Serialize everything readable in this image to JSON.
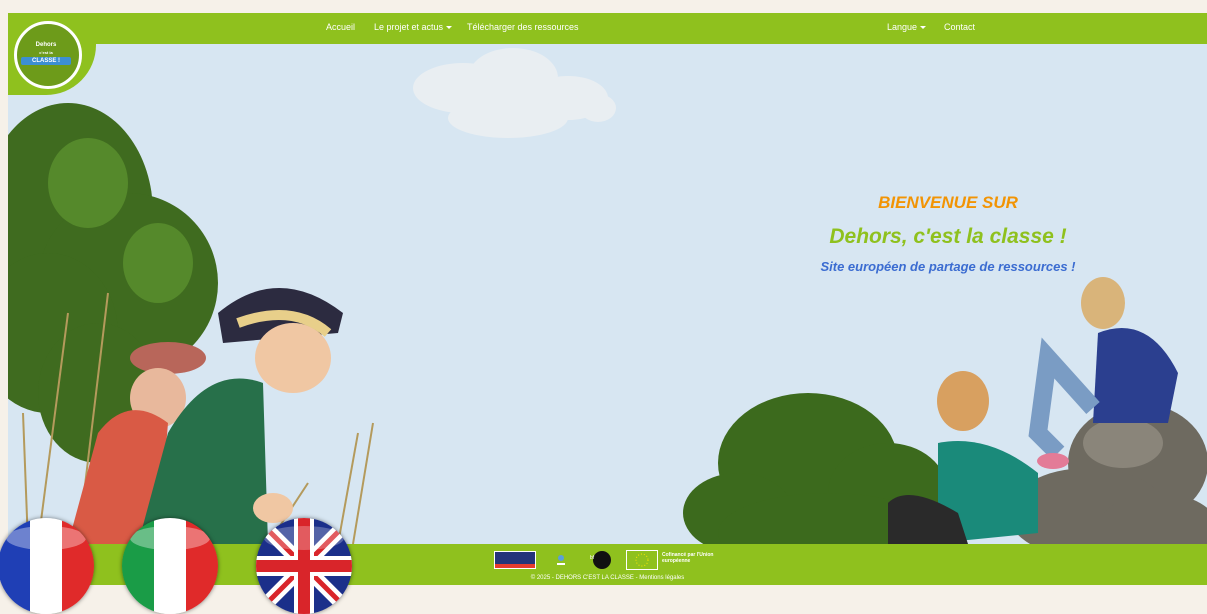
{
  "nav": {
    "items": [
      {
        "label": "Accueil"
      },
      {
        "label": "Le projet et actus"
      },
      {
        "label": "Télécharger des ressources"
      },
      {
        "label": "Langue"
      },
      {
        "label": "Contact"
      }
    ]
  },
  "logo": {
    "line1": "Dehors",
    "line2": "c'est la",
    "line3": "CLASSE !"
  },
  "welcome": {
    "line1": "BIENVENUE SUR",
    "line2": "Dehors, c'est la classe !",
    "line3": "Site européen de partage de ressources !"
  },
  "footer": {
    "copyright": "© 2025 - DEHORS C'EST LA CLASSE - Mentions légales",
    "eu_label": "Cofinancé par l'Union européenne"
  },
  "flags": [
    {
      "language": "Français"
    },
    {
      "language": "Italiano"
    },
    {
      "language": "English"
    }
  ],
  "colors": {
    "brand_green": "#8fc11e",
    "orange": "#f29404",
    "blue": "#3b6cd1",
    "sky": "#d7e6f2"
  }
}
